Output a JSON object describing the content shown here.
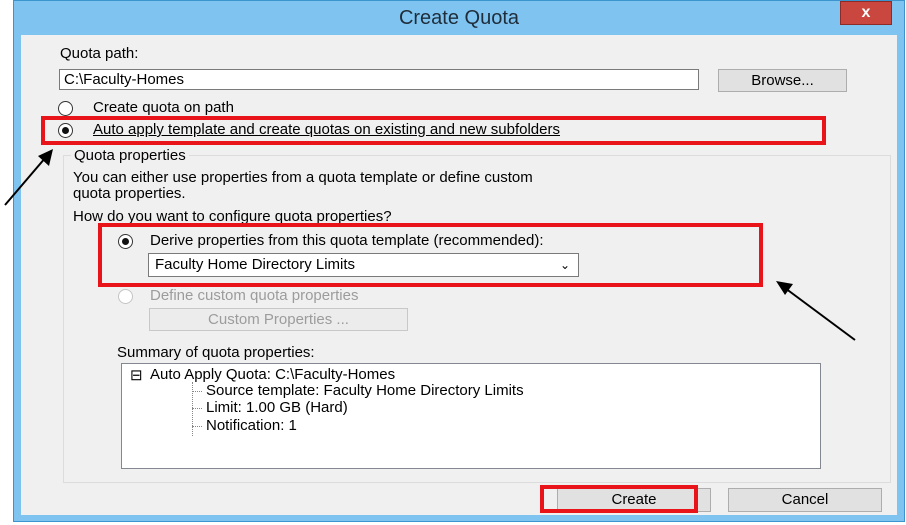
{
  "window": {
    "title": "Create Quota",
    "close_label": "x"
  },
  "quota_path": {
    "label": "Quota path:",
    "value": "C:\\Faculty-Homes",
    "browse_label": "Browse..."
  },
  "mode": {
    "option_create": "Create quota on path",
    "option_auto": "Auto apply template and create quotas on existing and new subfolders",
    "selected": "auto"
  },
  "quota_properties": {
    "group_label": "Quota properties",
    "description_line1": "You can either use properties from a quota template or define custom",
    "description_line2": "quota properties.",
    "question": "How do you want to configure quota properties?",
    "option_derive": "Derive properties from this quota template (recommended):",
    "template_selected": "Faculty Home Directory Limits",
    "option_custom": "Define custom quota properties",
    "custom_button": "Custom Properties ...",
    "summary_label": "Summary of quota properties:",
    "summary": {
      "root": "Auto Apply Quota: C:\\Faculty-Homes",
      "children": [
        "Source template: Faculty Home Directory Limits",
        "Limit: 1.00 GB (Hard)",
        "Notification: 1"
      ]
    }
  },
  "footer": {
    "create_label": "Create",
    "cancel_label": "Cancel"
  },
  "colors": {
    "annotation_red": "#e8141a",
    "title_bar": "#7fc4f0",
    "close_red": "#c9473e"
  }
}
